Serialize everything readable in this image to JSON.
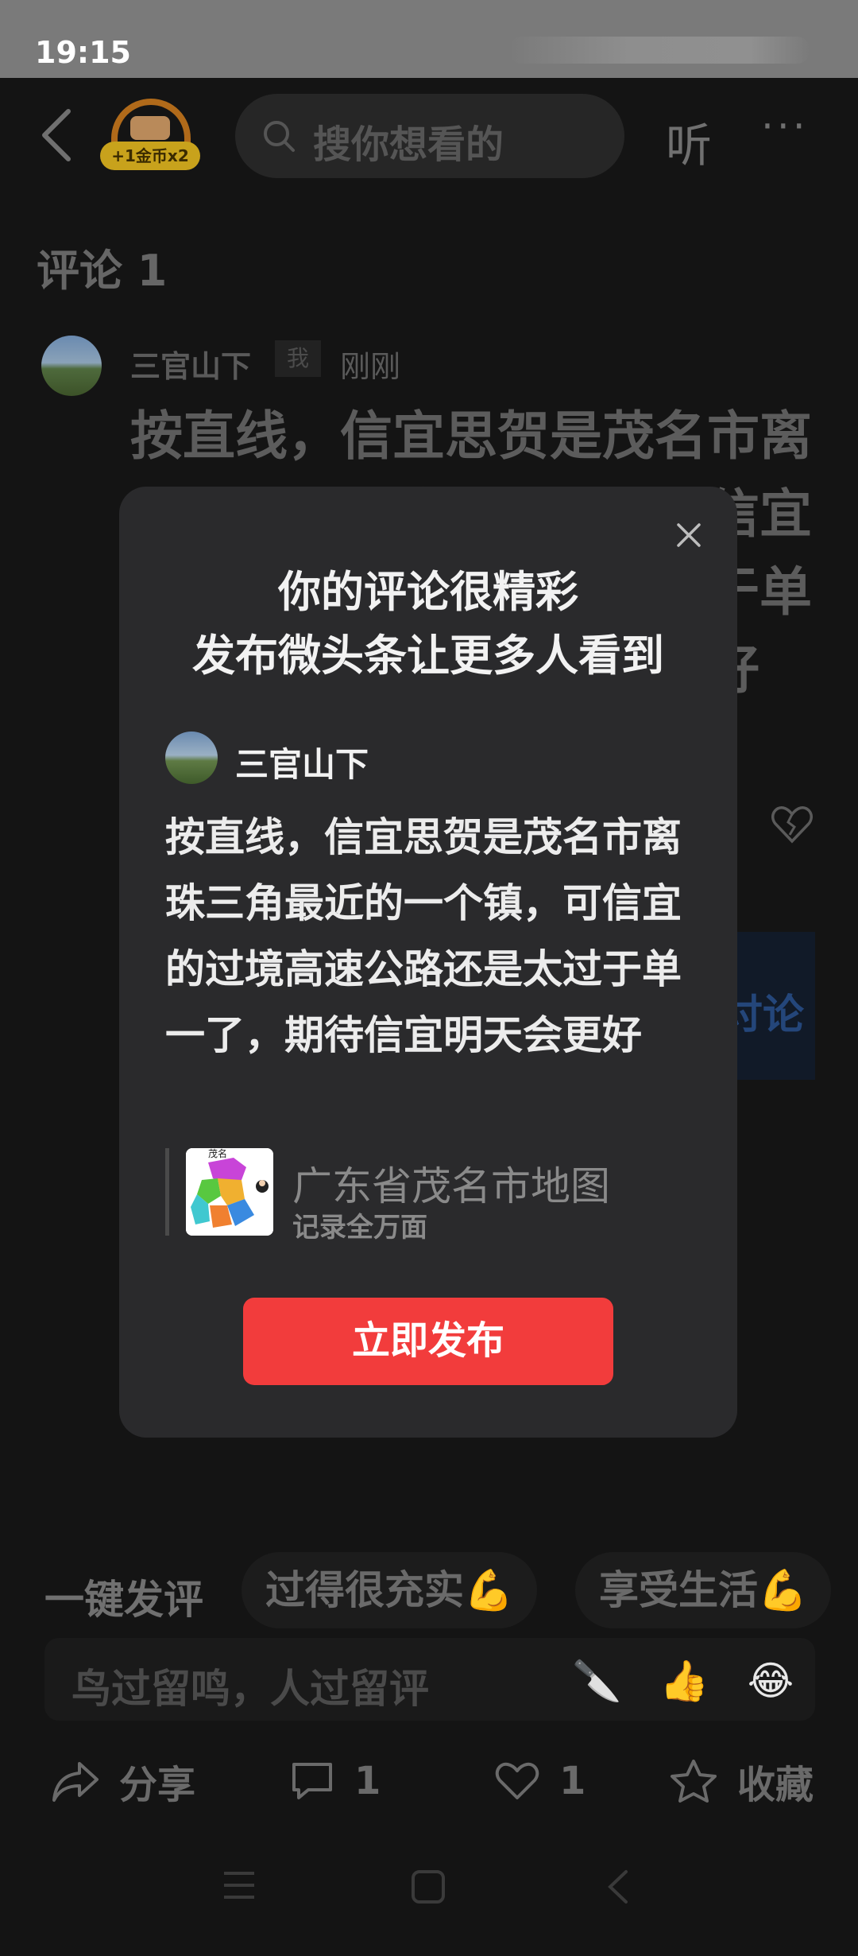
{
  "status_bar": {
    "time": "19:15"
  },
  "header": {
    "coin_badge": "+1金币x2",
    "search_placeholder": "搜你想看的",
    "listen_label": "听",
    "more_label": "···"
  },
  "comments": {
    "title": "评论 1",
    "item": {
      "author": "三官山下",
      "me_tag": "我",
      "time": "刚刚",
      "text": "按直线，信宜思贺是茂名市离珠三角最近的一个镇，可信宜的过境高速公路还是太过于单一了，期待信宜明天会更好"
    },
    "background_fragments": [
      "讨论"
    ]
  },
  "dialog": {
    "title_line1": "你的评论很精彩",
    "title_line2": "发布微头条让更多人看到",
    "author": "三官山下",
    "body": "按直线，信宜思贺是茂名市离珠三角最近的一个镇，可信宜的过境高速公路还是太过于单一了，期待信宜明天会更好",
    "link_title": "广东省茂名市地图",
    "link_subtitle": "记录全万面",
    "thumb_caption": "茂名",
    "publish_button": "立即发布"
  },
  "quick_replies": {
    "label": "一键发评",
    "chips": [
      "过得很充实💪",
      "享受生活💪"
    ]
  },
  "input": {
    "placeholder": "鸟过留鸣，人过留评",
    "emojis": [
      "🔪",
      "👍",
      "😂"
    ]
  },
  "action_bar": {
    "share": "分享",
    "comment_count": "1",
    "like_count": "1",
    "favorite": "收藏"
  },
  "colors": {
    "accent_red": "#f23c3c",
    "dialog_bg": "#2a2a2c",
    "page_bg": "#141414"
  }
}
